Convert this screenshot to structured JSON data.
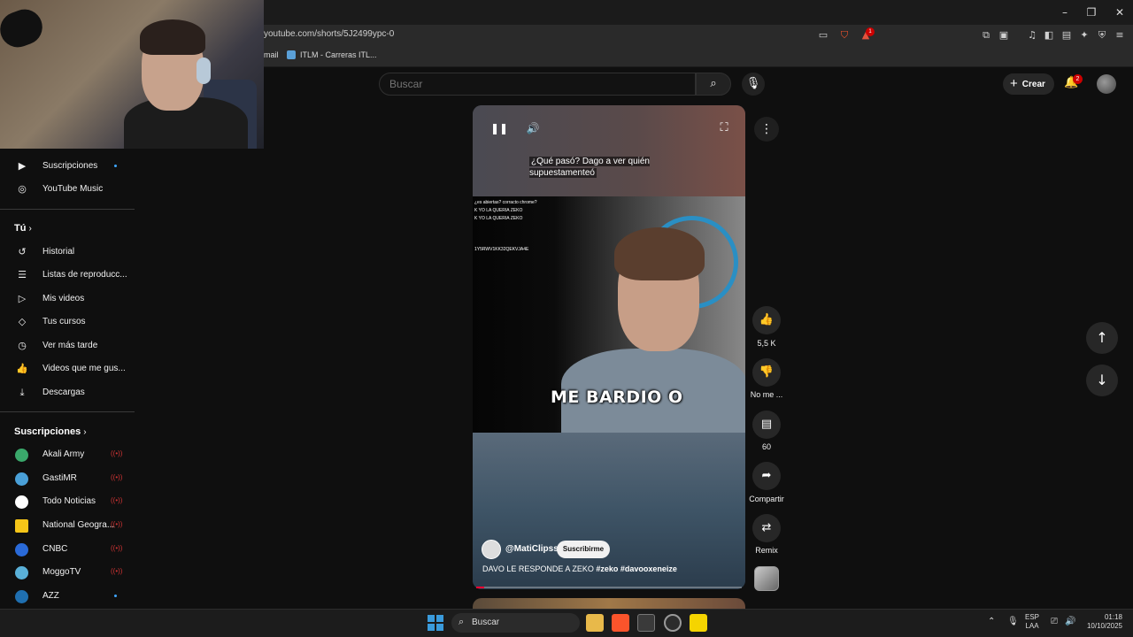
{
  "browser": {
    "url": "youtube.com/shorts/5J2499ypc-0",
    "bookmarks": [
      "mail",
      "ITLM - Carreras ITL..."
    ],
    "shield_count": "",
    "alert_count": "1"
  },
  "header": {
    "search_placeholder": "Buscar",
    "create_label": "Crear",
    "notifications_count": "2"
  },
  "sidebar": {
    "top_items": [
      {
        "label": "Suscripciones",
        "icon": "subscriptions-icon",
        "dot": true
      },
      {
        "label": "YouTube Music",
        "icon": "youtube-music-icon"
      }
    ],
    "you_heading": "Tú",
    "you_items": [
      {
        "label": "Historial",
        "icon": "history-icon"
      },
      {
        "label": "Listas de reproducc...",
        "icon": "playlists-icon"
      },
      {
        "label": "Mis videos",
        "icon": "my-videos-icon"
      },
      {
        "label": "Tus cursos",
        "icon": "courses-icon"
      },
      {
        "label": "Ver más tarde",
        "icon": "watch-later-icon"
      },
      {
        "label": "Videos que me gus...",
        "icon": "liked-videos-icon"
      },
      {
        "label": "Descargas",
        "icon": "downloads-icon"
      }
    ],
    "subs_heading": "Suscripciones",
    "subscriptions": [
      {
        "label": "Akali Army",
        "live": true,
        "color": "#3aa86b"
      },
      {
        "label": "GastiMR",
        "live": true,
        "color": "#4aa0d8"
      },
      {
        "label": "Todo Noticias",
        "live": true,
        "color": "#ffffff"
      },
      {
        "label": "National Geogra...",
        "live": true,
        "color": "#f5c518"
      },
      {
        "label": "CNBC",
        "live": true,
        "color": "#2a6ad8"
      },
      {
        "label": "MoggoTV",
        "live": true,
        "color": "#5ab0d8"
      },
      {
        "label": "AZZ",
        "live": false,
        "color": "#1f6fb0"
      }
    ]
  },
  "short": {
    "subtitle": "¿Qué pasó? Dago a ver quién supuestamenteó",
    "caption": "ME BARDIO O",
    "overlay_lines": [
      "¿es abiertas? corracto chrome?",
      "K YO LA QUERIA ZEKO",
      "K YO LA QUERIA ZEKO",
      "1Y5RWV1KK32QEKVJA4E"
    ],
    "channel": "@MatiClipss",
    "subscribe_label": "Suscribirme",
    "title_text": "DAVO LE RESPONDE A ZEKO ",
    "title_tags": "#zeko #davooxeneize",
    "progress": 0.03
  },
  "actions": {
    "likes": "5,5 K",
    "dislike_label": "No me ...",
    "comments": "60",
    "share_label": "Compartir",
    "remix_label": "Remix"
  },
  "taskbar": {
    "search_label": "Buscar",
    "lang_line1": "ESP",
    "lang_line2": "LAA",
    "time": "01:18",
    "date": "10/10/2025"
  },
  "colors": {
    "accent_red": "#ff0033",
    "background": "#0f0f0f",
    "live_red": "#cc3333",
    "dot_blue": "#3ea6ff"
  }
}
